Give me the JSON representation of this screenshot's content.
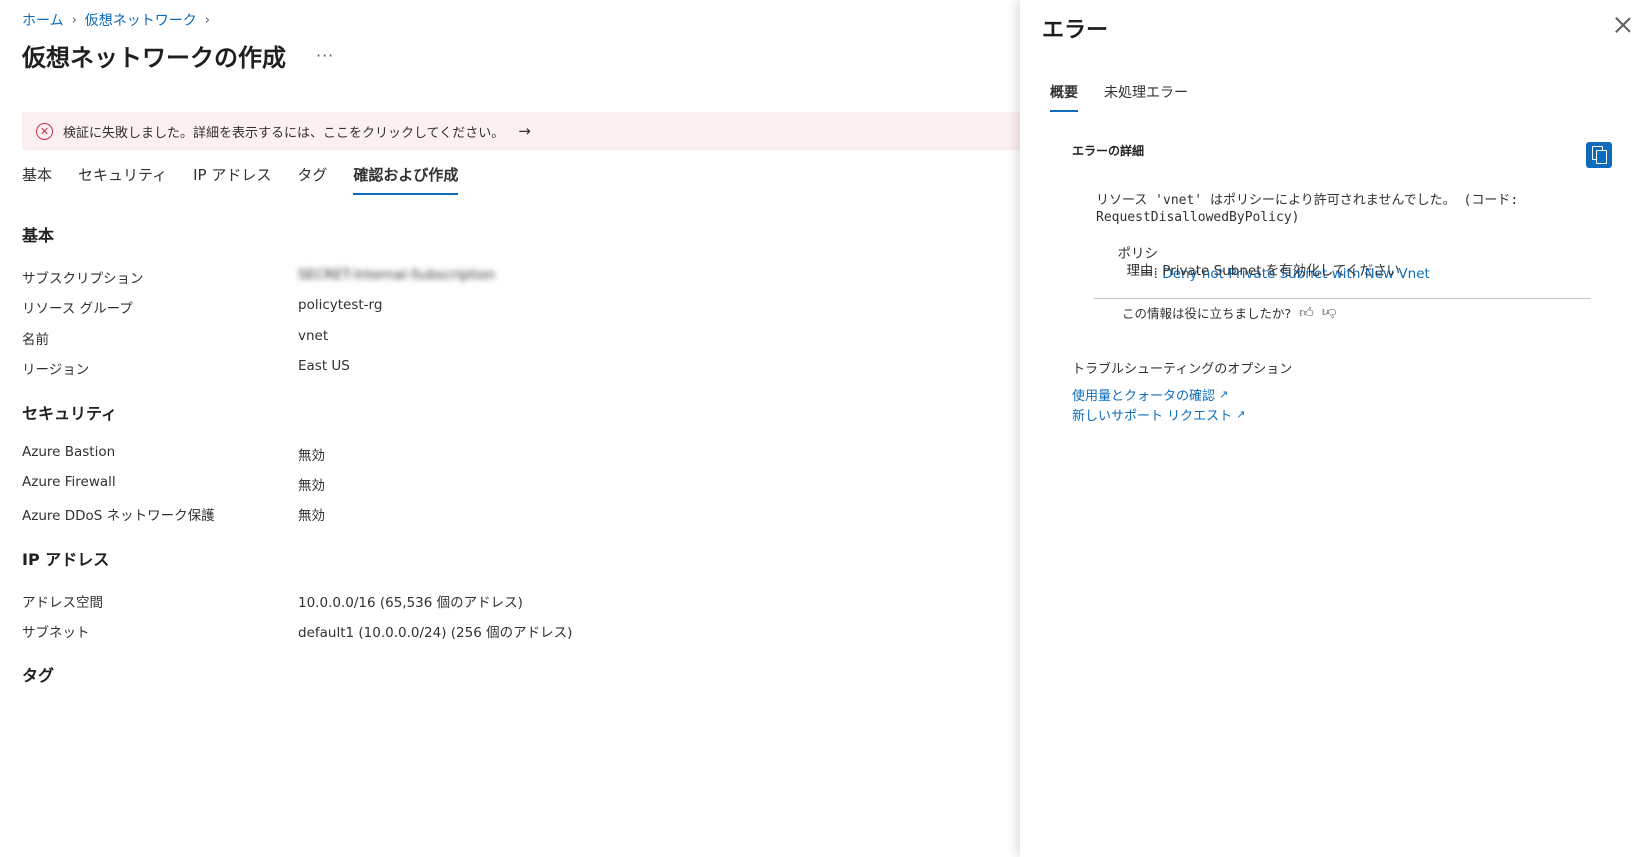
{
  "breadcrumb": {
    "home": "ホーム",
    "vnet": "仮想ネットワーク"
  },
  "page": {
    "title": "仮想ネットワークの作成",
    "more": "···"
  },
  "banner": {
    "text": "検証に失敗しました。詳細を表示するには、ここをクリックしてください。",
    "arrow": "→"
  },
  "tabs": [
    {
      "label": "基本"
    },
    {
      "label": "セキュリティ"
    },
    {
      "label": "IP アドレス"
    },
    {
      "label": "タグ"
    },
    {
      "label": "確認および作成",
      "active": true
    }
  ],
  "sections": {
    "basics": {
      "title": "基本",
      "rows": [
        {
          "label": "サブスクリプション",
          "value": "SECRET-Internal-Subscription"
        },
        {
          "label": "リソース グループ",
          "value": "policytest-rg"
        },
        {
          "label": "名前",
          "value": "vnet"
        },
        {
          "label": "リージョン",
          "value": "East US"
        }
      ]
    },
    "security": {
      "title": "セキュリティ",
      "rows": [
        {
          "label": "Azure Bastion",
          "value": "無効"
        },
        {
          "label": "Azure Firewall",
          "value": "無効"
        },
        {
          "label": "Azure DDoS ネットワーク保護",
          "value": "無効"
        }
      ]
    },
    "ip": {
      "title": "IP アドレス",
      "rows": [
        {
          "label": "アドレス空間",
          "value": "10.0.0.0/16 (65,536 個のアドレス)"
        },
        {
          "label": "サブネット",
          "value": "default1 (10.0.0.0/24) (256 個のアドレス)"
        }
      ]
    },
    "tags": {
      "title": "タグ"
    }
  },
  "panel": {
    "title": "エラー",
    "tabs": [
      {
        "label": "概要",
        "active": true
      },
      {
        "label": "未処理エラー"
      }
    ],
    "detail_title": "エラーの詳細",
    "message": "リソース 'vnet' はポリシーにより許可されませんでした。 (コード: RequestDisallowedByPolicy)",
    "policy_key": "ポリシー:",
    "policy_value": "Deny not Private Subnet with New Vnet",
    "reason_key": "理由:",
    "reason_value": "Private Subnet を有効化してください",
    "feedback": "この情報は役に立ちましたか?",
    "troubleshoot_title": "トラブルシューティングのオプション",
    "links": [
      "使用量とクォータの確認",
      "新しいサポート リクエスト"
    ]
  },
  "colors": {
    "accent": "#0f6cbd",
    "error": "#c4314b",
    "banner_bg": "#fdf0f0"
  }
}
